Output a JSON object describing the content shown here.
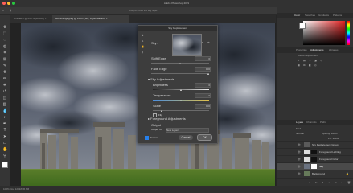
{
  "app": {
    "title": "Adobe Photoshop 2021",
    "hint": "Drag to move the sky layer",
    "zoom_status": "100% Doc 12.4M/36.6M"
  },
  "tabs": [
    {
      "label": "Untitled-1 @ 66.7% (RGB/8) ×"
    },
    {
      "label": "stonehenge.jpeg @ 100% (Sky, Layer Mask/8) ×"
    }
  ],
  "options_bar": {
    "zoom": "100%",
    "checkboxes": [
      "Resize Windows to Fit",
      "Zoom All Windows",
      "Scrubby Zoom"
    ],
    "buttons": [
      "100%",
      "Fit Screen",
      "Fill Screen"
    ]
  },
  "right_panel": {
    "top_tabs": [
      "Color",
      "Swatches",
      "Gradients",
      "Patterns"
    ],
    "mid_tabs": [
      "Properties",
      "Adjustments",
      "Libraries"
    ],
    "mid_subtitle": "Add an adjustment",
    "layers_tabs": [
      "Layers",
      "Channels",
      "Paths"
    ],
    "layers_kind": "Kind",
    "blend_mode": "Normal",
    "opacity_label": "Opacity: 100%",
    "fill_label": "Fill: 100%",
    "layers": [
      {
        "name": "Sky Replacement Group",
        "selected": false
      },
      {
        "name": "Foreground Lighting",
        "selected": false
      },
      {
        "name": "Foreground Color",
        "selected": false
      },
      {
        "name": "Sky",
        "selected": true
      },
      {
        "name": "Background",
        "selected": false
      }
    ]
  },
  "dialog": {
    "title": "Sky Replacement",
    "sky_label": "Sky:",
    "shift_edge_label": "Shift Edge",
    "shift_edge_value": "0",
    "fade_edge_label": "Fade Edge",
    "fade_edge_value": "100",
    "sky_adjustments_label": "Sky Adjustments",
    "brightness_label": "Brightness",
    "brightness_value": "0",
    "temperature_label": "Temperature",
    "temperature_value": "0",
    "scale_label": "Scale",
    "scale_value": "100",
    "flip_label": "Flip",
    "foreground_label": "Foreground Adjustments",
    "output_label": "Output",
    "output_to_label": "Output To:",
    "output_to_value": "New Layers",
    "preview_label": "Preview",
    "cancel_label": "Cancel",
    "ok_label": "OK"
  },
  "colors": {
    "accent": "#2680eb",
    "temperature_gradient_start": "#4a8fe0",
    "temperature_gradient_end": "#e0c04a"
  }
}
